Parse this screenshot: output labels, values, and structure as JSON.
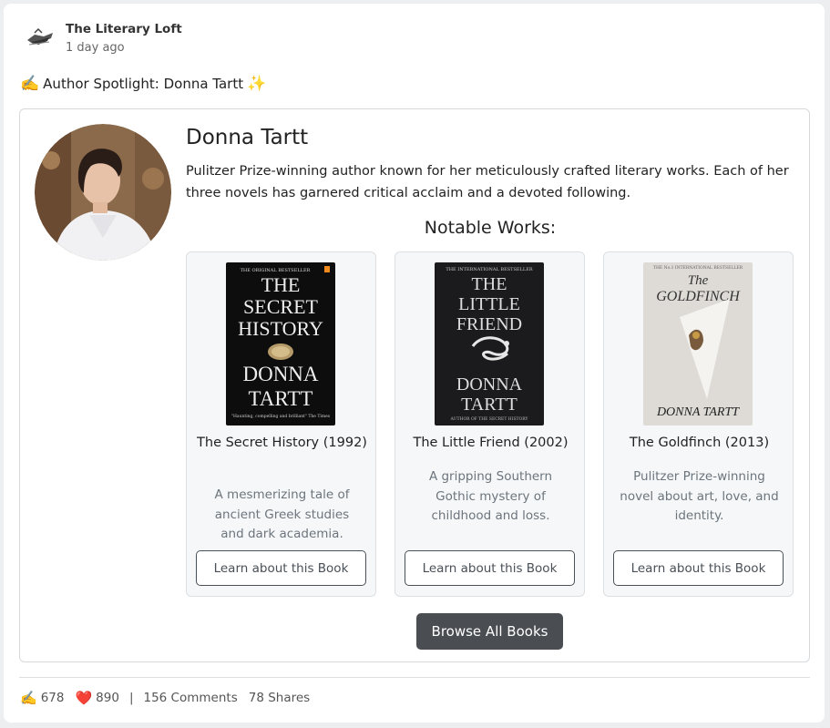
{
  "post": {
    "page_name": "The Literary Loft",
    "time": "1 day ago",
    "text_emoji_left": "✍️",
    "text": "Author Spotlight: Donna Tartt",
    "text_emoji_right": "✨"
  },
  "author": {
    "name": "Donna Tartt",
    "bio": "Pulitzer Prize-winning author known for her meticulously crafted literary works. Each of her three novels has garnered critical acclaim and a devoted following.",
    "works_heading": "Notable Works:"
  },
  "books": [
    {
      "title": "The Secret History (1992)",
      "description": "A mesmerizing tale of ancient Greek studies and dark academia.",
      "button": "Learn about this Book",
      "cover": {
        "top": "THE ORIGINAL BESTSELLER",
        "lines": [
          "THE",
          "SECRET",
          "HISTORY"
        ],
        "author": [
          "DONNA",
          "TARTT"
        ],
        "quote": "\"Haunting, compelling and brilliant\" The Times"
      }
    },
    {
      "title": "The Little Friend (2002)",
      "description": "A gripping Southern Gothic mystery of childhood and loss.",
      "button": "Learn about this Book",
      "cover": {
        "top": "THE INTERNATIONAL BESTSELLER",
        "lines": [
          "THE",
          "LITTLE",
          "FRIEND"
        ],
        "author": [
          "DONNA",
          "TARTT"
        ],
        "bottom": "AUTHOR OF THE SECRET HISTORY"
      }
    },
    {
      "title": "The Goldfinch (2013)",
      "description": "Pulitzer Prize-winning novel about art, love, and identity.",
      "button": "Learn about this Book",
      "cover": {
        "top": "THE No.1 INTERNATIONAL BESTSELLER",
        "lines": [
          "The",
          "GOLDFINCH"
        ],
        "author": [
          "DONNA TARTT"
        ]
      }
    }
  ],
  "browse_button": "Browse All Books",
  "footer": {
    "emoji_a": "✍️",
    "count_a": "678",
    "emoji_b": "❤️",
    "count_b": "890",
    "separator": "|",
    "comments": "156 Comments",
    "shares": "78 Shares"
  }
}
